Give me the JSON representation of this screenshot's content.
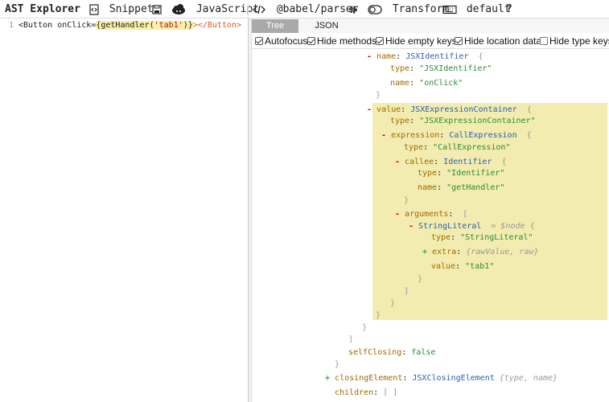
{
  "toolbar": {
    "brand": "AST Explorer",
    "snippet": "Snippet",
    "language": "JavaScript",
    "parser": "@babel/parser",
    "transform": "Transform",
    "keymap": "default",
    "help": "?"
  },
  "editor": {
    "line_number": "1",
    "code": {
      "open_tag": "<Button onClick=",
      "brace_open": "{",
      "call": "getHandler(",
      "arg": "'tab1'",
      "call_close": ")",
      "brace_close": "}",
      "close_open": "></",
      "close_name": "Button",
      "close_end": ">"
    }
  },
  "tabs": {
    "tree": "Tree",
    "json": "JSON"
  },
  "options": {
    "autofocus": "Autofocus",
    "hide_methods": "Hide methods",
    "hide_empty_keys": "Hide empty keys",
    "hide_location_data": "Hide location data",
    "hide_type_keys": "Hide type keys"
  },
  "tree": {
    "name_key": "name",
    "name_type": "JSXIdentifier",
    "type_key": "type",
    "name_type_str": "\"JSXIdentifier\"",
    "name_name_str": "\"onClick\"",
    "value_key": "value",
    "value_type": "JSXExpressionContainer",
    "value_type_str": "\"JSXExpressionContainer\"",
    "expression_key": "expression",
    "expression_type": "CallExpression",
    "expression_type_str": "\"CallExpression\"",
    "callee_key": "callee",
    "callee_type": "Identifier",
    "callee_type_str": "\"Identifier\"",
    "callee_name_str": "\"getHandler\"",
    "arguments_key": "arguments",
    "literal_type": "StringLiteral",
    "node_note": "= $node",
    "literal_type_str": "\"StringLiteral\"",
    "extra_key": "extra",
    "extra_summary": "{rawValue, raw}",
    "literal_value_str": "\"tab1\"",
    "self_closing_key": "selfClosing",
    "self_closing_val": "false",
    "closing_key": "closingElement",
    "closing_type": "JSXClosingElement",
    "closing_summary": "{type, name}",
    "children_key": "children",
    "children_val": "[ ]"
  },
  "colors": {
    "highlight": "#f2ecb0",
    "key": "#a06a00",
    "string": "#2d8a3a",
    "node_type": "#2a5fb0",
    "collapse_minus": "#cc0000",
    "expand_plus": "#33aa33"
  }
}
